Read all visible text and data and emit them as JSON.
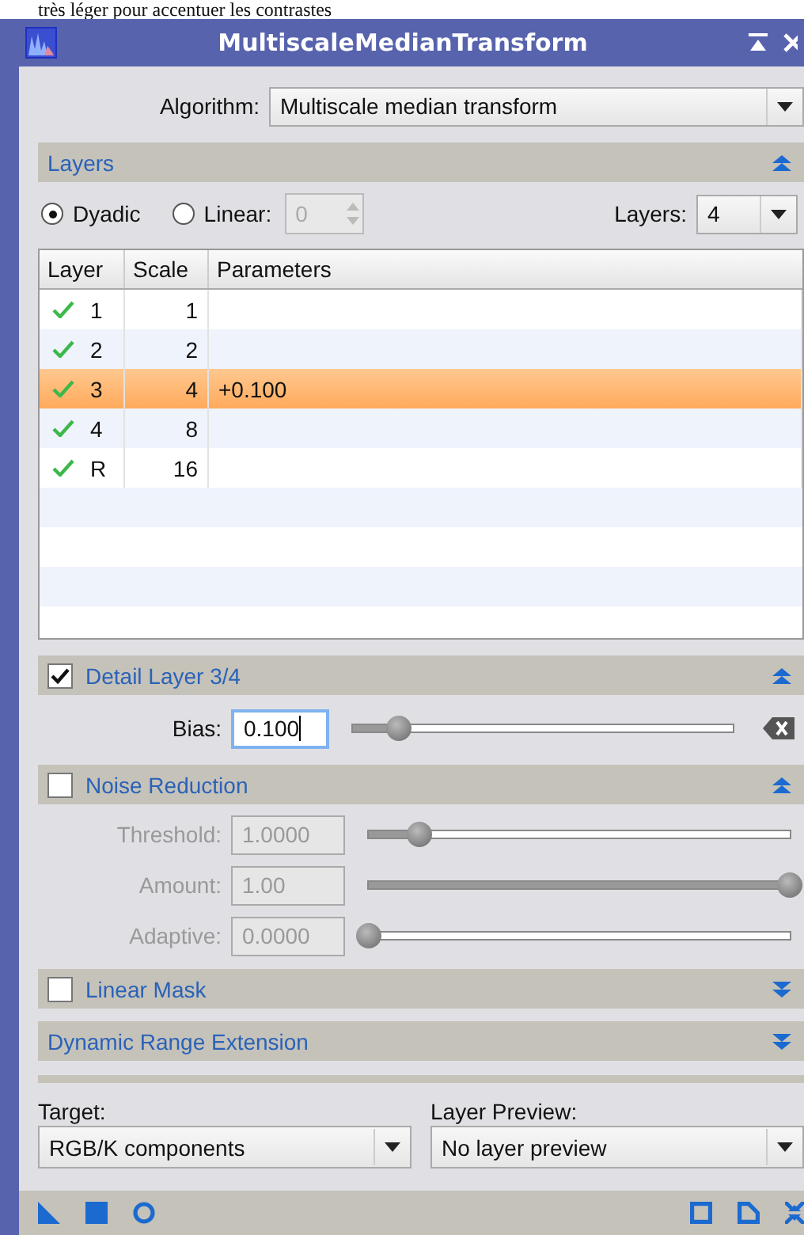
{
  "page_text": "très léger pour accentuer les contrastes",
  "window": {
    "title": "MultiscaleMedianTransform"
  },
  "algorithm": {
    "label": "Algorithm:",
    "value": "Multiscale median transform"
  },
  "layers_section": {
    "title": "Layers",
    "expanded": true
  },
  "scaling": [
    {
      "label": "Dyadic",
      "selected": true
    },
    {
      "label": "Linear:",
      "selected": false
    }
  ],
  "linear_value": "0",
  "layers_count": {
    "label": "Layers:",
    "value": "4"
  },
  "table": {
    "columns": [
      "Layer",
      "Scale",
      "Parameters"
    ],
    "rows": [
      {
        "enabled": true,
        "layer": "1",
        "scale": "1",
        "selected": false
      },
      {
        "enabled": true,
        "layer": "2",
        "scale": "2",
        "selected": false
      },
      {
        "enabled": true,
        "layer": "3",
        "scale": "4",
        "parameters": "+0.100",
        "selected": true
      },
      {
        "enabled": true,
        "layer": "4",
        "scale": "8",
        "selected": false
      },
      {
        "enabled": true,
        "layer": "R",
        "scale": "16",
        "selected": false
      }
    ]
  },
  "detail": {
    "title": "Detail Layer 3/4",
    "checked": true,
    "expanded": true,
    "bias": {
      "label": "Bias:",
      "value": "0.100",
      "level": 0.12
    }
  },
  "noise": {
    "title": "Noise Reduction",
    "checked": false,
    "expanded": true,
    "params": [
      {
        "label": "Threshold:",
        "value": "1.0000",
        "level": 0.12
      },
      {
        "label": "Amount:",
        "value": "1.00",
        "level": 1
      },
      {
        "label": "Adaptive:",
        "value": "0.0000",
        "level": 0
      }
    ]
  },
  "linear_mask": {
    "title": "Linear Mask",
    "checked": false,
    "expanded": false
  },
  "dynamic_range": {
    "title": "Dynamic Range Extension",
    "expanded": false
  },
  "target": {
    "label": "Target:",
    "value": "RGB/K components"
  },
  "layer_preview": {
    "label": "Layer Preview:",
    "value": "No layer preview"
  }
}
